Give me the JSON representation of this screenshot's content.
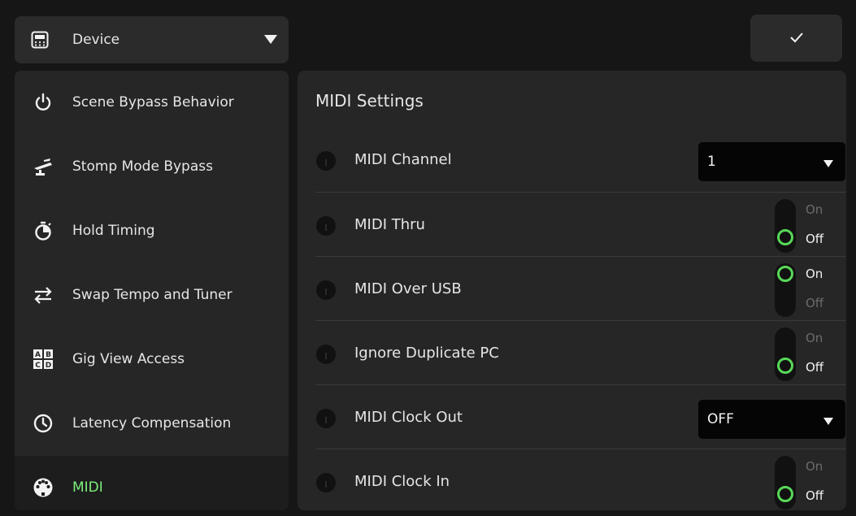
{
  "header": {
    "device_dropdown_label": "Device",
    "confirm_icon": "checkmark-icon"
  },
  "sidebar": {
    "items": [
      {
        "label": "Scene Bypass Behavior",
        "icon": "power-icon",
        "active": false
      },
      {
        "label": "Stomp Mode Bypass",
        "icon": "stomp-pedal-icon",
        "active": false
      },
      {
        "label": "Hold Timing",
        "icon": "timer-icon",
        "active": false
      },
      {
        "label": "Swap Tempo and Tuner",
        "icon": "swap-arrows-icon",
        "active": false
      },
      {
        "label": "Gig View Access",
        "icon": "abcd-grid-icon",
        "active": false
      },
      {
        "label": "Latency Compensation",
        "icon": "clock-icon",
        "active": false
      },
      {
        "label": "MIDI",
        "icon": "midi-connector-icon",
        "active": true
      }
    ]
  },
  "main": {
    "title": "MIDI Settings",
    "rows": [
      {
        "label": "MIDI Channel",
        "control": "select",
        "value": "1"
      },
      {
        "label": "MIDI Thru",
        "control": "toggle",
        "on_label": "On",
        "off_label": "Off",
        "state": "Off"
      },
      {
        "label": "MIDI Over USB",
        "control": "toggle",
        "on_label": "On",
        "off_label": "Off",
        "state": "On"
      },
      {
        "label": "Ignore Duplicate PC",
        "control": "toggle",
        "on_label": "On",
        "off_label": "Off",
        "state": "Off"
      },
      {
        "label": "MIDI Clock Out",
        "control": "select",
        "value": "OFF"
      },
      {
        "label": "MIDI Clock In",
        "control": "toggle",
        "on_label": "On",
        "off_label": "Off",
        "state": "Off"
      }
    ]
  },
  "colors": {
    "accent_green": "#58d858",
    "active_text": "#7cef7c",
    "panel_bg": "#262626",
    "page_bg": "#161616"
  }
}
